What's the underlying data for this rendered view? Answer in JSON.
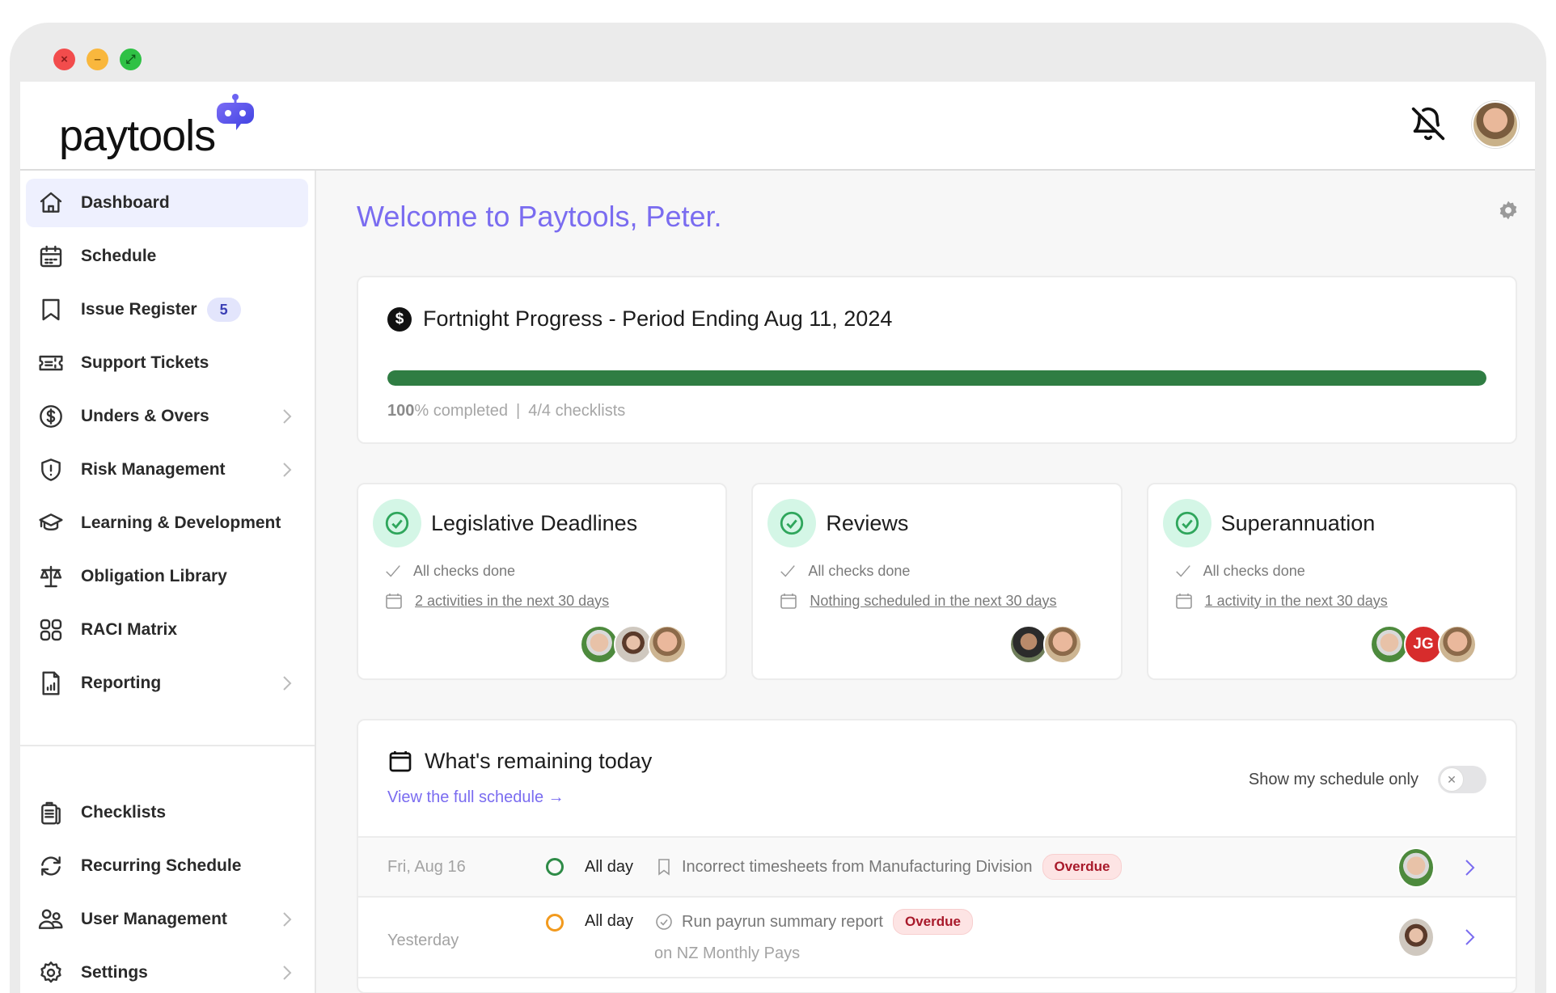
{
  "window": {
    "controls": [
      "close",
      "minimize",
      "maximize"
    ]
  },
  "header": {
    "logo_text": "paytools",
    "logo_icon": "robot-chat-icon",
    "notifications_icon": "bell-off-icon",
    "user_avatar": "Peter"
  },
  "sidebar": {
    "items": [
      {
        "label": "Dashboard",
        "icon": "home-icon",
        "active": true
      },
      {
        "label": "Schedule",
        "icon": "calendar-icon"
      },
      {
        "label": "Issue Register",
        "icon": "bookmark-icon",
        "badge": "5"
      },
      {
        "label": "Support Tickets",
        "icon": "ticket-icon"
      },
      {
        "label": "Unders & Overs",
        "icon": "dollar-circle-icon",
        "chevron": true
      },
      {
        "label": "Risk Management",
        "icon": "shield-alert-icon",
        "chevron": true
      },
      {
        "label": "Learning & Development",
        "icon": "graduation-cap-icon"
      },
      {
        "label": "Obligation Library",
        "icon": "scales-icon"
      },
      {
        "label": "RACI Matrix",
        "icon": "grid-icon"
      },
      {
        "label": "Reporting",
        "icon": "report-chart-icon",
        "chevron": true
      }
    ],
    "secondary_items": [
      {
        "label": "Checklists",
        "icon": "clipboard-icon"
      },
      {
        "label": "Recurring Schedule",
        "icon": "refresh-icon"
      },
      {
        "label": "User Management",
        "icon": "users-icon",
        "chevron": true
      },
      {
        "label": "Settings",
        "icon": "gear-icon",
        "chevron": true
      }
    ]
  },
  "main": {
    "welcome": "Welcome to Paytools, Peter.",
    "progress": {
      "title": "Fortnight Progress - Period Ending Aug 11, 2024",
      "percent": 100,
      "percent_label": "100",
      "completed_suffix": "% completed",
      "separator": "|",
      "checklists": "4/4 checklists",
      "bar_color": "#2f7d43"
    },
    "summary_cards": [
      {
        "title": "Legislative Deadlines",
        "checks": "All checks done",
        "schedule": "2 activities in the next 30 days",
        "assignees": [
          "avatar-1",
          "avatar-2",
          "avatar-3"
        ]
      },
      {
        "title": "Reviews",
        "checks": "All checks done",
        "schedule": "Nothing scheduled in the next 30 days",
        "assignees": [
          "avatar-4",
          "avatar-3"
        ]
      },
      {
        "title": "Superannuation",
        "checks": "All checks done",
        "schedule": "1 activity in the next 30 days",
        "assignees": [
          "avatar-1",
          "JG",
          "avatar-3"
        ]
      }
    ],
    "remaining": {
      "title": "What's remaining today",
      "link": "View the full schedule →",
      "toggle_label": "Show my schedule only",
      "toggle_on": false,
      "rows": [
        {
          "date": "Fri, Aug 16",
          "status_color": "#2e8b47",
          "time": "All day",
          "type_icon": "bookmark-icon",
          "title": "Incorrect timesheets from Manufacturing Division",
          "badge": "Overdue",
          "subtitle": ""
        },
        {
          "date": "Yesterday",
          "status_color": "#f29a1e",
          "time": "All day",
          "type_icon": "check-circle-icon",
          "title": "Run payrun summary report",
          "badge": "Overdue",
          "subtitle": "on NZ Monthly Pays"
        }
      ]
    }
  }
}
